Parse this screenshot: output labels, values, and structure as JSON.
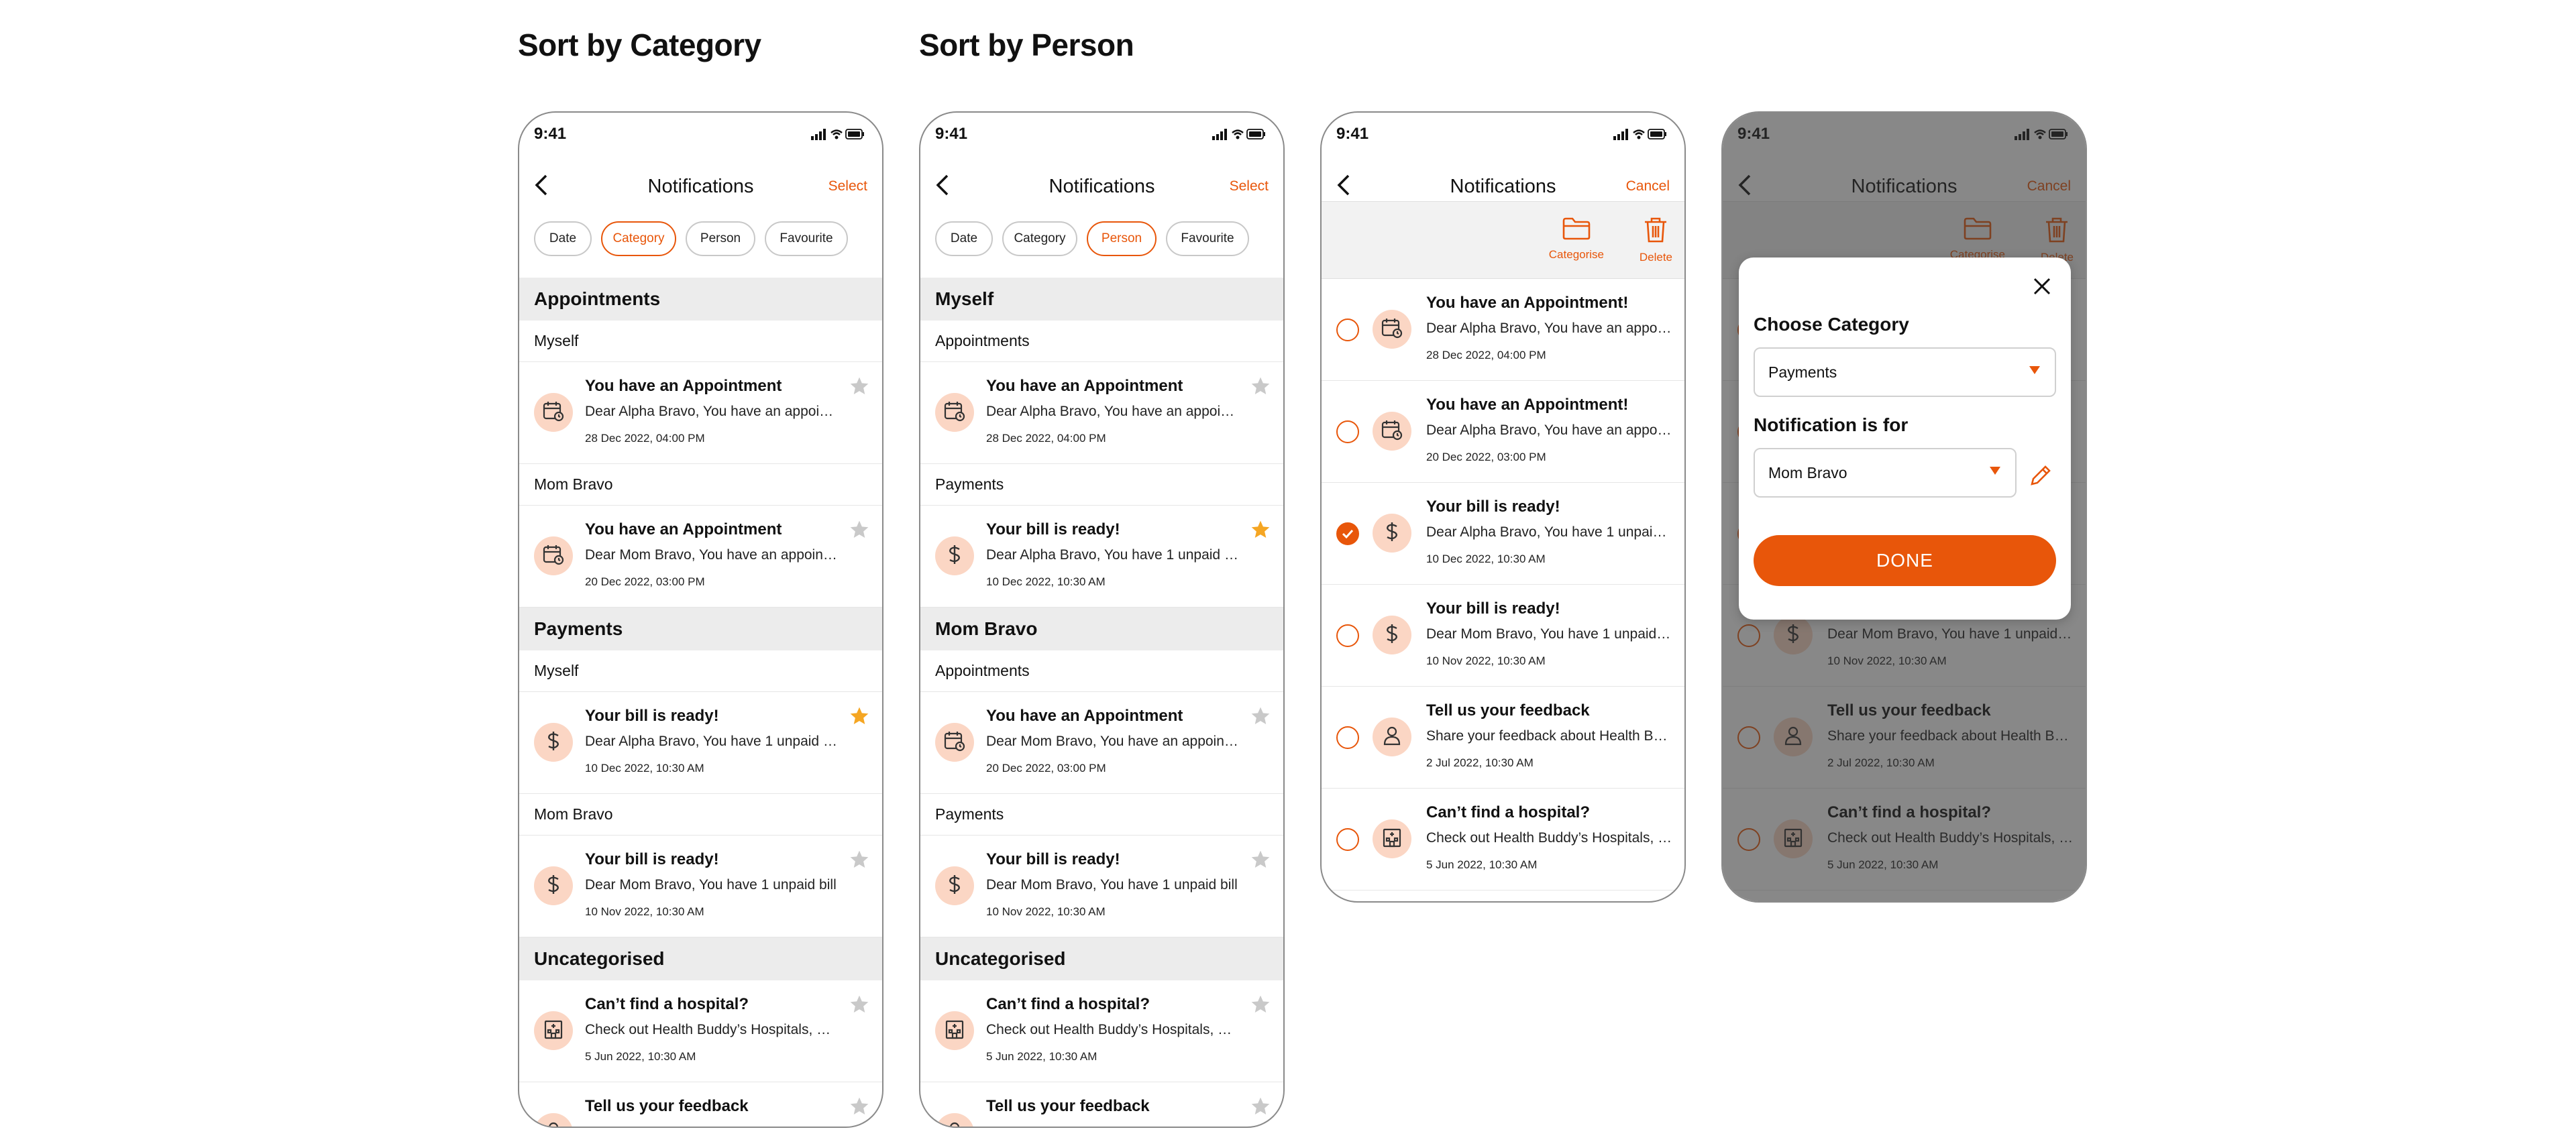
{
  "sections": {
    "category": "Sort by Category",
    "person": "Sort by Person"
  },
  "status": {
    "time": "9:41"
  },
  "nav": {
    "title": "Notifications",
    "select": "Select",
    "cancel": "Cancel"
  },
  "filters": [
    "Date",
    "Category",
    "Person",
    "Favourite"
  ],
  "active_filter": {
    "phone1": "Category",
    "phone2": "Person"
  },
  "toolbar": {
    "categorise": "Categorise",
    "delete": "Delete"
  },
  "phone1": {
    "groups": [
      {
        "name": "Appointments",
        "subs": [
          {
            "name": "Myself",
            "title": "You have an Appointment",
            "body": "Dear Alpha Bravo, You have an appointment scheduled",
            "time": "28 Dec 2022, 04:00 PM",
            "icon": "calendar-icon",
            "fav": false
          },
          {
            "name": "Mom Bravo",
            "title": "You have an Appointment",
            "body": "Dear Mom Bravo, You have an appointment scheduled",
            "time": "20 Dec 2022, 03:00 PM",
            "icon": "calendar-icon",
            "fav": false
          }
        ]
      },
      {
        "name": "Payments",
        "subs": [
          {
            "name": "Myself",
            "title": "Your bill is ready!",
            "body": "Dear Alpha Bravo, You have 1 unpaid bill",
            "time": "10 Dec 2022, 10:30 AM",
            "icon": "dollar-icon",
            "fav": true
          },
          {
            "name": "Mom Bravo",
            "title": "Your bill is ready!",
            "body": "Dear Mom Bravo, You have 1 unpaid bill",
            "time": "10 Nov 2022, 10:30 AM",
            "icon": "dollar-icon",
            "fav": false
          }
        ]
      },
      {
        "name": "Uncategorised",
        "items": [
          {
            "title": "Can’t find a hospital?",
            "body": "Check out Health Buddy’s Hospitals, Clinics",
            "time": "5 Jun 2022, 10:30 AM",
            "icon": "hospital-icon",
            "fav": false
          },
          {
            "title": "Tell us your feedback",
            "body": "",
            "time": "",
            "icon": "person-icon",
            "fav": false
          }
        ]
      }
    ]
  },
  "phone2": {
    "groups": [
      {
        "name": "Myself",
        "subs": [
          {
            "name": "Appointments",
            "title": "You have an Appointment",
            "body": "Dear Alpha Bravo, You have an appointment scheduled",
            "time": "28 Dec 2022, 04:00 PM",
            "icon": "calendar-icon",
            "fav": false
          },
          {
            "name": "Payments",
            "title": "Your bill is ready!",
            "body": "Dear Alpha Bravo, You have 1 unpaid bill",
            "time": "10 Dec 2022, 10:30 AM",
            "icon": "dollar-icon",
            "fav": true
          }
        ]
      },
      {
        "name": "Mom Bravo",
        "subs": [
          {
            "name": "Appointments",
            "title": "You have an Appointment",
            "body": "Dear Mom Bravo, You have an appointment scheduled",
            "time": "20 Dec 2022, 03:00 PM",
            "icon": "calendar-icon",
            "fav": false
          },
          {
            "name": "Payments",
            "title": "Your bill is ready!",
            "body": "Dear Mom Bravo, You have 1 unpaid bill",
            "time": "10 Nov 2022, 10:30 AM",
            "icon": "dollar-icon",
            "fav": false
          }
        ]
      },
      {
        "name": "Uncategorised",
        "items": [
          {
            "title": "Can’t find a hospital?",
            "body": "Check out Health Buddy’s Hospitals, Clinics",
            "time": "5 Jun 2022, 10:30 AM",
            "icon": "hospital-icon",
            "fav": false
          },
          {
            "title": "Tell us your feedback",
            "body": "",
            "time": "",
            "icon": "person-icon",
            "fav": false
          }
        ]
      }
    ]
  },
  "phone3": {
    "items": [
      {
        "title": "You have an Appointment!",
        "body": "Dear Alpha Bravo, You have an appointment scheduled",
        "time": "28 Dec 2022, 04:00 PM",
        "icon": "calendar-icon",
        "checked": false
      },
      {
        "title": "You have an Appointment!",
        "body": "Dear Alpha Bravo, You have an appointment scheduled",
        "time": "20 Dec 2022, 03:00 PM",
        "icon": "calendar-icon",
        "checked": false
      },
      {
        "title": "Your bill is ready!",
        "body": "Dear Alpha Bravo, You have 1 unpaid bill",
        "time": "10 Dec 2022, 10:30 AM",
        "icon": "dollar-icon",
        "checked": true
      },
      {
        "title": "Your bill is ready!",
        "body": "Dear Mom Bravo, You have 1 unpaid bill",
        "time": "10 Nov 2022, 10:30 AM",
        "icon": "dollar-icon",
        "checked": false
      },
      {
        "title": "Tell us your feedback",
        "body": "Share your feedback about Health Buddy",
        "time": "2 Jul 2022, 10:30 AM",
        "icon": "person-icon",
        "checked": false
      },
      {
        "title": "Can’t find a hospital?",
        "body": "Check out Health Buddy’s Hospitals, Clinics",
        "time": "5 Jun 2022, 10:30 AM",
        "icon": "hospital-icon",
        "checked": false
      }
    ]
  },
  "modal": {
    "category_label": "Choose Category",
    "category_value": "Payments",
    "for_label": "Notification is for",
    "for_value": "Mom Bravo",
    "done": "DONE"
  },
  "colors": {
    "accent": "#e8560a",
    "star_active": "#f5a623",
    "avatar_bg": "#fbd6c4",
    "group_bg": "#ececec"
  }
}
